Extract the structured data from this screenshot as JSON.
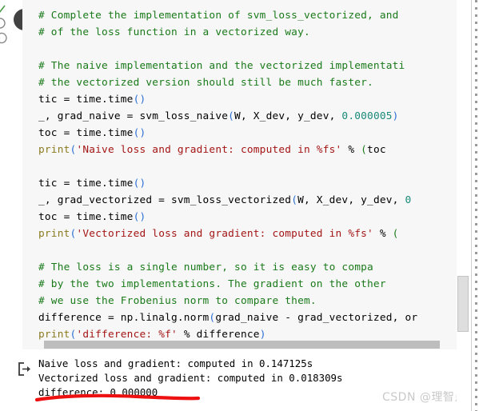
{
  "toolbar": {
    "run_button_label": "Run cell",
    "run_icon": "play-icon",
    "edge_icons": [
      "check-icon",
      "clock-icon",
      "refresh-icon"
    ]
  },
  "code_cell": {
    "language": "python",
    "lines": [
      "# Complete the implementation of svm_loss_vectorized, and",
      "# of the loss function in a vectorized way.",
      "",
      "# The naive implementation and the vectorized implementati",
      "# the vectorized version should still be much faster.",
      "tic = time.time()",
      "_, grad_naive = svm_loss_naive(W, X_dev, y_dev, 0.000005)",
      "toc = time.time()",
      "print('Naive loss and gradient: computed in %fs' % (toc",
      "",
      "tic = time.time()",
      "_, grad_vectorized = svm_loss_vectorized(W, X_dev, y_dev, 0",
      "toc = time.time()",
      "print('Vectorized loss and gradient: computed in %fs' % (",
      "",
      "# The loss is a single number, so it is easy to compa",
      "# by the two implementations. The gradient on the other",
      "# we use the Frobenius norm to compare them.",
      "difference = np.linalg.norm(grad_naive - grad_vectorized, or",
      "print('difference: %f' % difference)"
    ],
    "truncated_right": true
  },
  "output": {
    "icon": "output-arrow-icon",
    "lines": [
      "Naive loss and gradient: computed in 0.147125s",
      "Vectorized loss and gradient: computed in 0.018309s",
      "difference: 0.000000"
    ]
  },
  "annotation": {
    "type": "red-underline",
    "color": "#ee1111",
    "underlines_text": "difference: 0.000000"
  },
  "scrollbars": {
    "horizontal_present": true,
    "vertical_present": true
  },
  "watermark": {
    "text": "CSDN @理智点",
    "color": "#c9c9c9"
  },
  "colors": {
    "comment": "#1a7a1a",
    "string": "#a41515",
    "builtin": "#8a7a20",
    "number": "#1a8a7a",
    "punctuation": "#2b6fd4",
    "cell_background": "#f7f7f7",
    "page_background": "#ffffff",
    "run_button": "#424242",
    "scrollbar_thumb": "#bdbdbd"
  }
}
